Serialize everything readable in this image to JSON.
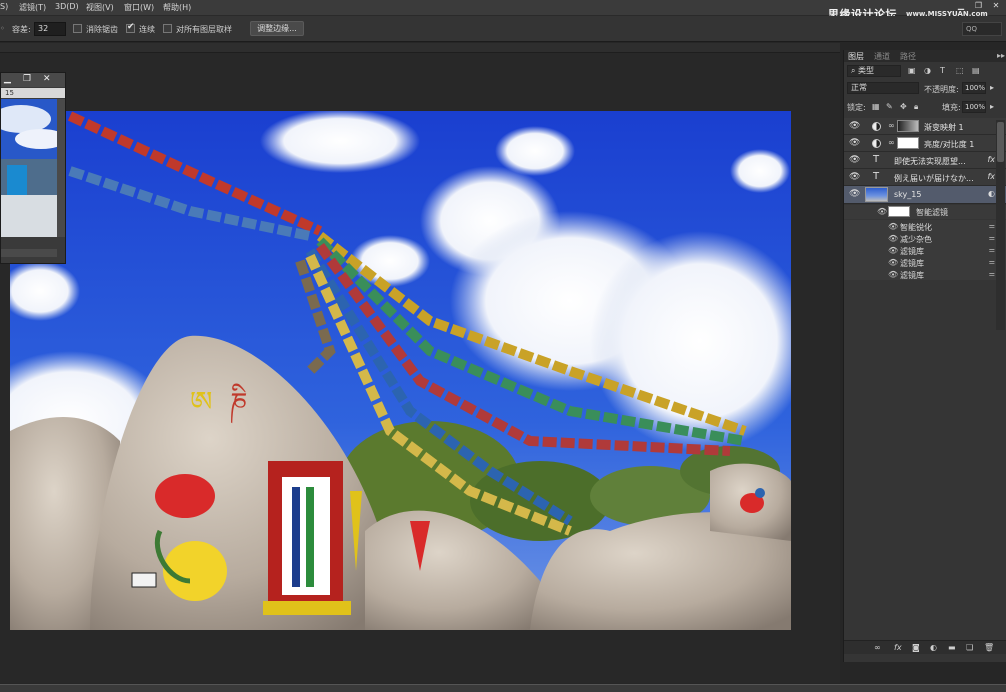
{
  "menubar": {
    "items": [
      {
        "label": "S)"
      },
      {
        "label": "滤镜(T)"
      },
      {
        "label": "3D(D)"
      },
      {
        "label": "视图(V)"
      },
      {
        "label": "窗口(W)"
      },
      {
        "label": "帮助(H)"
      }
    ],
    "watermark": "思缘设计论坛",
    "watermark_sub": "www.MISSYUAN.com"
  },
  "options": {
    "tolerance_label": "容差:",
    "tolerance_value": "32",
    "antialias_label": "消除锯齿",
    "contiguous_label": "连续",
    "sample_all_label": "对所有图层取样",
    "refine_edge_label": "调整边缘...",
    "workspace_value": "QQ"
  },
  "float_window": {
    "ruler_value": "15"
  },
  "panel": {
    "tabs": [
      {
        "label": "图层",
        "active": true
      },
      {
        "label": "通道",
        "active": false
      },
      {
        "label": "路径",
        "active": false
      }
    ],
    "filter_kind": "类型",
    "blend_mode": "正常",
    "opacity_label": "不透明度:",
    "opacity_value": "100%",
    "lock_label": "锁定:",
    "fill_label": "填充:",
    "fill_value": "100%",
    "layers": [
      {
        "name": "渐变映射 1",
        "kind": "adjustment-gradient"
      },
      {
        "name": "亮度/对比度 1",
        "kind": "adjustment-brightness"
      },
      {
        "name": "即使无法实现愿望...",
        "kind": "text",
        "fx": "fx"
      },
      {
        "name": "例え届いが届けなか...",
        "kind": "text",
        "fx": "fx"
      },
      {
        "name": "sky_15",
        "kind": "smart-object",
        "selected": true
      }
    ],
    "smart_filters_label": "智能滤镜",
    "filters": [
      {
        "name": "智能锐化"
      },
      {
        "name": "减少杂色"
      },
      {
        "name": "滤镜库"
      },
      {
        "name": "滤镜库"
      },
      {
        "name": "滤镜库"
      }
    ]
  },
  "colors": {
    "app_bg": "#262626",
    "panel_bg": "#353535",
    "selected_layer": "#535b6c"
  }
}
